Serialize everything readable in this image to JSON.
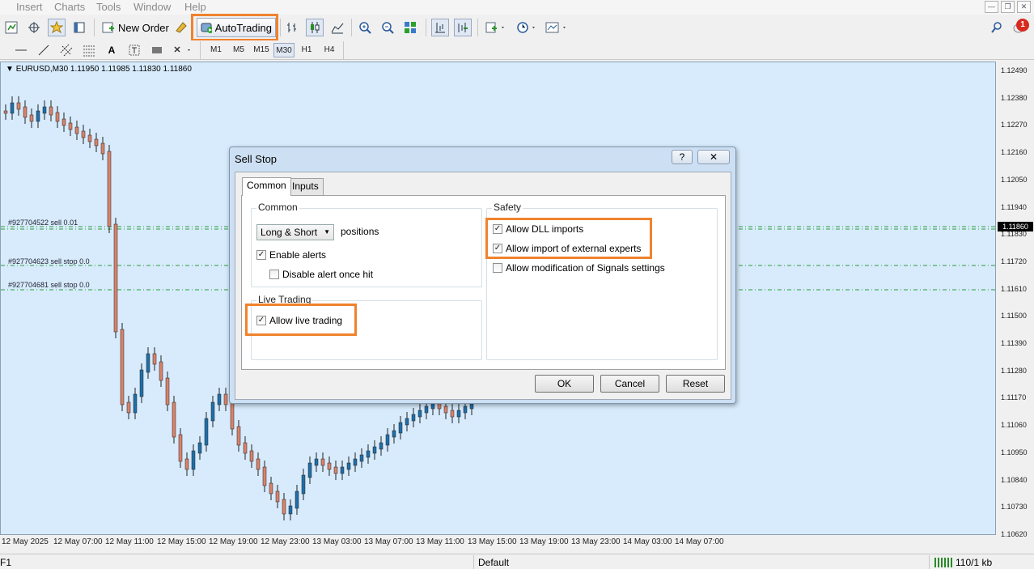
{
  "menu": [
    "Insert",
    "Charts",
    "Tools",
    "Window",
    "Help"
  ],
  "toolbar": {
    "new_order": "New Order",
    "autotrading": "AutoTrading",
    "notification_count": "1"
  },
  "timeframes": [
    "M1",
    "M5",
    "M15",
    "M30",
    "H1",
    "H4"
  ],
  "active_timeframe": "M30",
  "chart": {
    "header": "EURUSD,M30  1.11950 1.11985 1.11830 1.11860",
    "orders": [
      "#927704522 sell 0.01",
      "#927704623 sell stop 0.0",
      "#927704681 sell stop 0.0"
    ],
    "current_price": "1.11860",
    "price_labels": [
      "1.12490",
      "1.12380",
      "1.12270",
      "1.12160",
      "1.12050",
      "1.11940",
      "1.11830",
      "1.11720",
      "1.11610",
      "1.11500",
      "1.11390",
      "1.11280",
      "1.11170",
      "1.11060",
      "1.10950",
      "1.10840",
      "1.10730",
      "1.10620"
    ],
    "time_labels": [
      "12 May 2025",
      "12 May 07:00",
      "12 May 11:00",
      "12 May 15:00",
      "12 May 19:00",
      "12 May 23:00",
      "13 May 03:00",
      "13 May 07:00",
      "13 May 11:00",
      "13 May 15:00",
      "13 May 19:00",
      "13 May 23:00",
      "14 May 03:00",
      "14 May 07:00"
    ],
    "bull_color": "#1f6fa8",
    "bear_color": "#d9826a"
  },
  "dialog": {
    "title": "Sell Stop",
    "help": "?",
    "close": "✕",
    "tabs": [
      "Common",
      "Inputs"
    ],
    "common_group": {
      "title": "Common",
      "select_value": "Long & Short",
      "positions_label": "positions",
      "enable_alerts": "Enable alerts",
      "disable_alert_once": "Disable alert once hit"
    },
    "live_group": {
      "title": "Live Trading",
      "allow_live": "Allow live trading"
    },
    "safety_group": {
      "title": "Safety",
      "allow_dll": "Allow DLL imports",
      "allow_external": "Allow import of external experts",
      "allow_signals": "Allow modification of Signals settings"
    },
    "buttons": {
      "ok": "OK",
      "cancel": "Cancel",
      "reset": "Reset"
    }
  },
  "status": {
    "help": "F1",
    "profile": "Default",
    "traffic": "110/1 kb"
  }
}
